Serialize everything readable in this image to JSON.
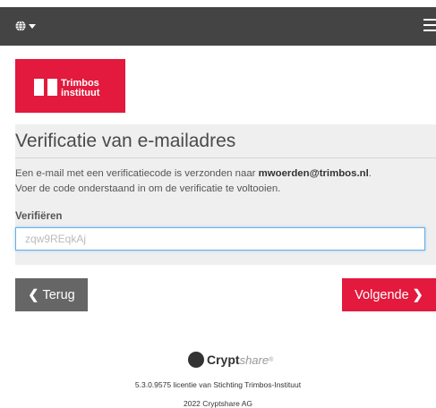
{
  "topbar": {
    "language_icon": "globe-icon",
    "menu_icon": "hamburger-icon"
  },
  "logo": {
    "line1": "Trimbos",
    "line2": "instituut",
    "color": "#e3193d"
  },
  "heading": "Verificatie van e-mailadres",
  "message": {
    "part1": "Een e-mail met een verificatiecode is verzonden naar ",
    "email": "mwoerden@trimbos.nl",
    "part2": ".",
    "line2": "Voer de code onderstaand in om de verificatie te voltooien."
  },
  "field": {
    "label": "Verifiëren",
    "value": "zqw9REqkAj"
  },
  "buttons": {
    "back": "Terug",
    "next": "Volgende"
  },
  "footer": {
    "brand_bold": "Crypt",
    "brand_italic": "share",
    "brand_sup": "®",
    "license": "5.3.0.9575 licentie van Stichting Trimbos-Instituut",
    "copyright": "2022 Cryptshare AG"
  },
  "colors": {
    "topbar": "#444444",
    "primary": "#e3193d",
    "secondary": "#666666",
    "panel": "#efefef"
  }
}
